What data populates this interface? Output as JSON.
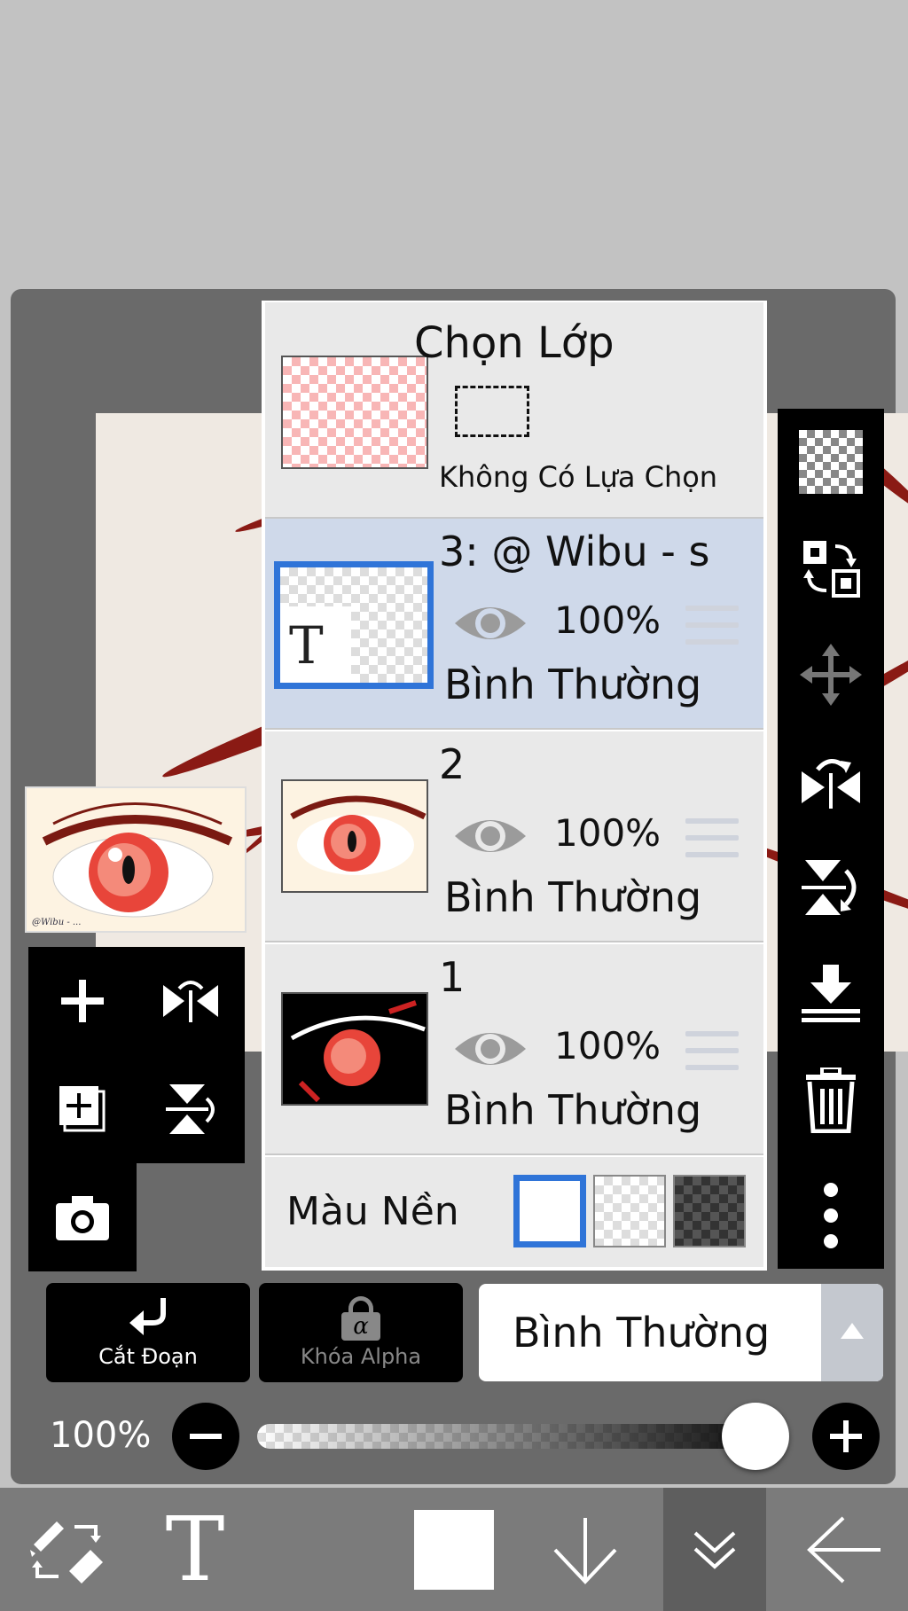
{
  "layer_panel": {
    "selection_layer": {
      "title": "Chọn Lớp",
      "status": "Không Có Lựa Chọn"
    },
    "layers": [
      {
        "name": "3: @ Wibu - s",
        "opacity": "100%",
        "blend_mode": "Bình Thường",
        "selected": true,
        "thumb_glyph": "T"
      },
      {
        "name": "2",
        "opacity": "100%",
        "blend_mode": "Bình Thường",
        "selected": false
      },
      {
        "name": "1",
        "opacity": "100%",
        "blend_mode": "Bình Thường",
        "selected": false
      }
    ],
    "background": {
      "label": "Màu Nền",
      "options": [
        "white",
        "transparent",
        "dark-checker"
      ],
      "selected": "white"
    }
  },
  "controls": {
    "clipping_label": "Cắt Đoạn",
    "alpha_lock_label": "Khóa Alpha",
    "alpha_lock_glyph": "α",
    "blend_mode_value": "Bình Thường",
    "opacity_label": "100%",
    "opacity_value": 1.0
  },
  "thumbnail": {
    "signature": "@Wibu - ..."
  },
  "colors": {
    "accent": "#2f74d8",
    "selected_row": "#cfd9ea",
    "panel_bg": "#6a6a6a",
    "toolbar_bg": "#000000",
    "bottom_bar": "#7b7b7b"
  },
  "icons": {
    "right_toolbar": [
      "transparency-icon",
      "swap-layer-icon",
      "move-icon",
      "flip-horizontal-icon",
      "flip-vertical-icon",
      "merge-down-icon",
      "trash-icon",
      "more-icon"
    ],
    "left_toolbar": [
      "add-layer-icon",
      "flip-horizontal-icon",
      "duplicate-layer-icon",
      "flip-vertical-icon",
      "camera-icon"
    ],
    "bottom_bar": [
      "brush-eraser-swap-icon",
      "text-tool-icon",
      "color-swatch-icon",
      "arrow-down-icon",
      "double-chevron-down-icon",
      "back-arrow-icon"
    ]
  },
  "bottom_bar": {
    "text_tool_glyph": "T"
  }
}
